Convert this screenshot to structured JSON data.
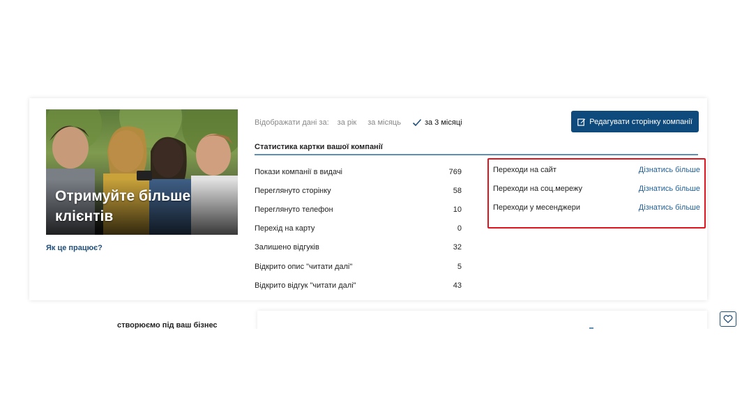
{
  "promo": {
    "title": "Отримуйте більше клієнтів",
    "how_link": "Як це працює?"
  },
  "filter": {
    "label": "Відображати дані за:",
    "options": [
      "за рік",
      "за місяць",
      "за 3 місяці"
    ],
    "selected": "за 3 місяці"
  },
  "edit_button": {
    "label": "Редагувати сторінку компанії"
  },
  "section_title": "Статистика картки вашої компанії",
  "stats": [
    {
      "label": "Покази компанії в видачі",
      "value": "769"
    },
    {
      "label": "Переглянуто сторінку",
      "value": "58"
    },
    {
      "label": "Переглянуто телефон",
      "value": "10"
    },
    {
      "label": "Перехід на карту",
      "value": "0"
    },
    {
      "label": "Залишено відгуків",
      "value": "32"
    },
    {
      "label": "Відкрито опис \"читати далі\"",
      "value": "5"
    },
    {
      "label": "Відкрито відгук \"читати далі\"",
      "value": "43"
    }
  ],
  "transitions": [
    {
      "label": "Переходи на сайт",
      "link": "Дізнатись більше"
    },
    {
      "label": "Переходи на соц.мережу",
      "link": "Дізнатись більше"
    },
    {
      "label": "Переходи у месенджери",
      "link": "Дізнатись більше"
    }
  ],
  "bottom_text": "створюємо під ваш бізнес",
  "colors": {
    "primary": "#0e4a7c",
    "link": "#1f5f99",
    "highlight_border": "#e0141e",
    "divider": "#5b8fb5"
  },
  "icons": {
    "edit": "edit-icon",
    "check": "check-icon",
    "favorite": "heart-icon"
  }
}
